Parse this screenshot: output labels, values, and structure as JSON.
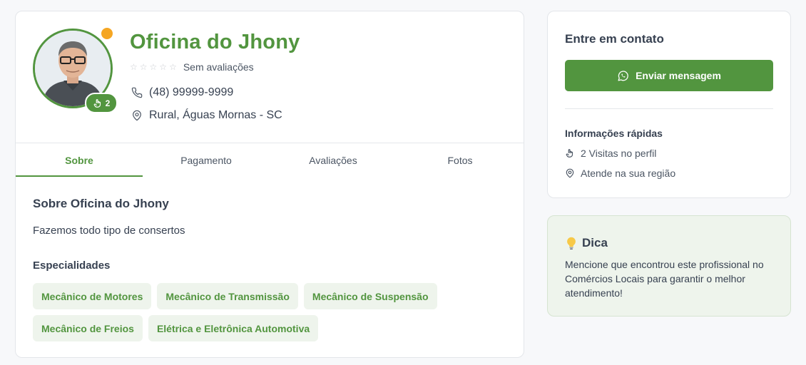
{
  "profile": {
    "name": "Oficina do Jhony",
    "visits_badge": "2",
    "rating_text": "Sem avaliações",
    "stars": 5,
    "phone": "(48) 99999-9999",
    "location": "Rural, Águas Mornas - SC"
  },
  "tabs": [
    {
      "label": "Sobre",
      "active": true
    },
    {
      "label": "Pagamento",
      "active": false
    },
    {
      "label": "Avaliações",
      "active": false
    },
    {
      "label": "Fotos",
      "active": false
    }
  ],
  "about": {
    "title": "Sobre Oficina do Jhony",
    "text": "Fazemos todo tipo de consertos",
    "specialties_title": "Especialidades",
    "specialties": [
      "Mecânico de Motores",
      "Mecânico de Transmissão",
      "Mecânico de Suspensão",
      "Mecânico de Freios",
      "Elétrica e Eletrônica Automotiva"
    ]
  },
  "contact": {
    "title": "Entre em contato",
    "button_label": "Enviar mensagem",
    "quick_title": "Informações rápidas",
    "quick_visits": "2 Visitas no perfil",
    "quick_region": "Atende na sua região"
  },
  "tip": {
    "title": "Dica",
    "text": "Mencione que encontrou este profissional no Comércios Locais para garantir o melhor atendimento!"
  },
  "colors": {
    "accent": "#52953f",
    "status": "#f5a623",
    "chip_bg": "#eef4ec"
  },
  "icons": [
    "pointer-hand-icon",
    "phone-icon",
    "map-pin-icon",
    "whatsapp-icon",
    "lightbulb-icon",
    "star-icon"
  ]
}
